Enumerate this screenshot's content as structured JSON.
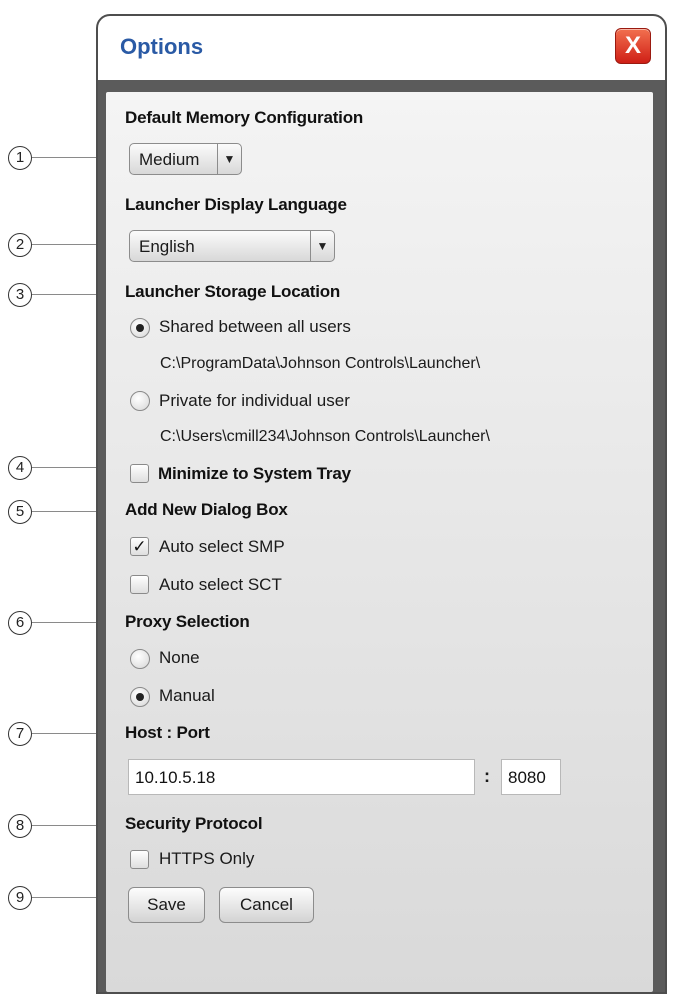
{
  "window": {
    "title": "Options",
    "close_label": "X"
  },
  "callouts": [
    "1",
    "2",
    "3",
    "4",
    "5",
    "6",
    "7",
    "8",
    "9"
  ],
  "memory": {
    "heading": "Default Memory Configuration",
    "selected": "Medium"
  },
  "language": {
    "heading": "Launcher Display Language",
    "selected": "English"
  },
  "storage": {
    "heading": "Launcher Storage Location",
    "options": [
      {
        "label": "Shared between all users",
        "path": "C:\\ProgramData\\Johnson Controls\\Launcher\\",
        "checked": true
      },
      {
        "label": "Private for individual user",
        "path": "C:\\Users\\cmill234\\Johnson Controls\\Launcher\\",
        "checked": false
      }
    ]
  },
  "minimize": {
    "label": "Minimize to System Tray",
    "checked": false
  },
  "add_new_dialog": {
    "heading": "Add New Dialog Box",
    "options": [
      {
        "label": "Auto select SMP",
        "checked": true
      },
      {
        "label": "Auto select SCT",
        "checked": false
      }
    ]
  },
  "proxy": {
    "heading": "Proxy Selection",
    "options": [
      {
        "label": "None",
        "checked": false
      },
      {
        "label": "Manual",
        "checked": true
      }
    ]
  },
  "host_port": {
    "heading": "Host : Port",
    "host": "10.10.5.18",
    "separator": ":",
    "port": "8080"
  },
  "security": {
    "heading": "Security Protocol",
    "https_label": "HTTPS Only",
    "checked": false
  },
  "buttons": {
    "save": "Save",
    "cancel": "Cancel"
  },
  "check_mark": "✓"
}
